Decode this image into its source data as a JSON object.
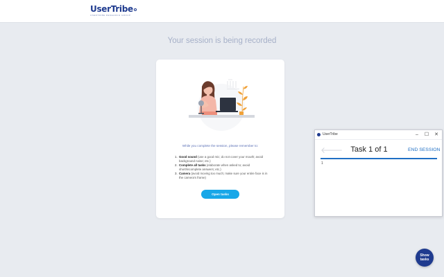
{
  "header": {
    "logo_text": "UserTribe",
    "logo_tagline": "USERTRIBE RESEARCH GROUP"
  },
  "main": {
    "status_title": "Your session is being recorded"
  },
  "card": {
    "remember_text": "While you complete the session, please remember to:",
    "guidelines": [
      {
        "number": "1.",
        "title": "Good sound",
        "text": " (use a good mic; do not cover your mouth; avoid background noise; etc.)"
      },
      {
        "number": "2.",
        "title": "Complete all tasks",
        "text": " (elaborate when asked to; avoid short/incomplete answers; etc.)"
      },
      {
        "number": "3.",
        "title": "Camera",
        "text": " (avoid moving too much; make sure your entire face is in the camera's frame)"
      }
    ],
    "open_tasks_label": "Open tasks"
  },
  "task_window": {
    "app_title": "UserTribe",
    "minimize_icon": "–",
    "maximize_icon": "☐",
    "close_icon": "✕",
    "back_icon": "🡐",
    "task_title": "Task 1 of 1",
    "end_session_label": "END SESSION",
    "current_item": "1"
  },
  "show_tasks": {
    "line1": "Show",
    "line2": "tasks"
  },
  "colors": {
    "background": "#e8ebf0",
    "brand_navy": "#1f3b8f",
    "accent_blue": "#18a7e8",
    "link_blue": "#1f6fc4",
    "illustration_orange": "#f0a23a",
    "illustration_pink": "#f4b7a8"
  }
}
